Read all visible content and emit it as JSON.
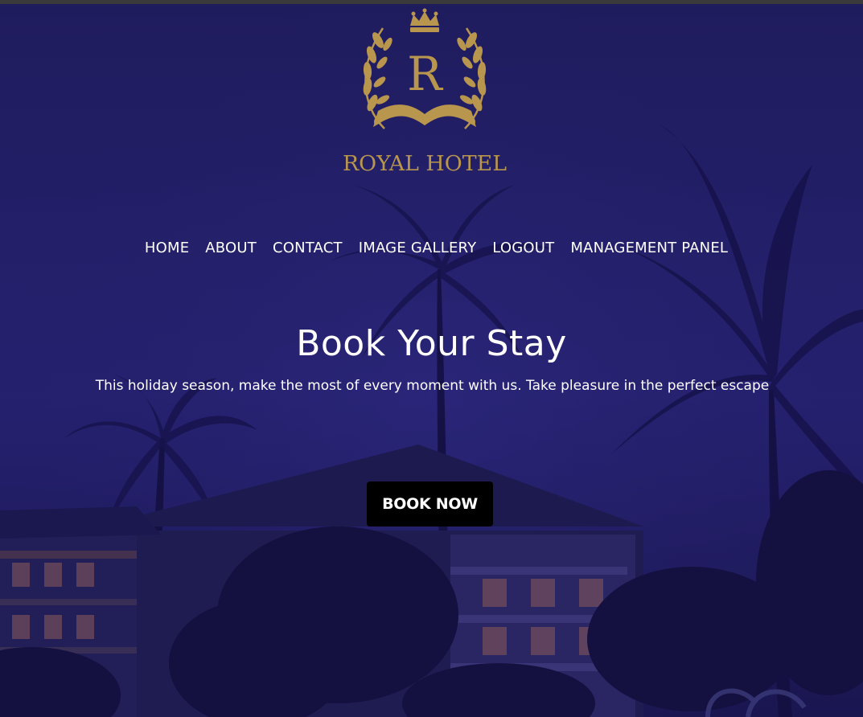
{
  "brand": {
    "monogram": "R",
    "name": "ROYAL HOTEL",
    "gold_color": "#b8964e"
  },
  "nav": {
    "items": [
      {
        "label": "HOME"
      },
      {
        "label": "ABOUT"
      },
      {
        "label": "CONTACT"
      },
      {
        "label": "IMAGE GALLERY"
      },
      {
        "label": "LOGOUT"
      },
      {
        "label": "MANAGEMENT PANEL"
      }
    ]
  },
  "hero": {
    "title": "Book Your Stay",
    "subtitle": "This holiday season, make the most of every moment with us. Take pleasure in the perfect escape",
    "cta_label": "BOOK NOW",
    "overlay_color": "#231f66"
  }
}
